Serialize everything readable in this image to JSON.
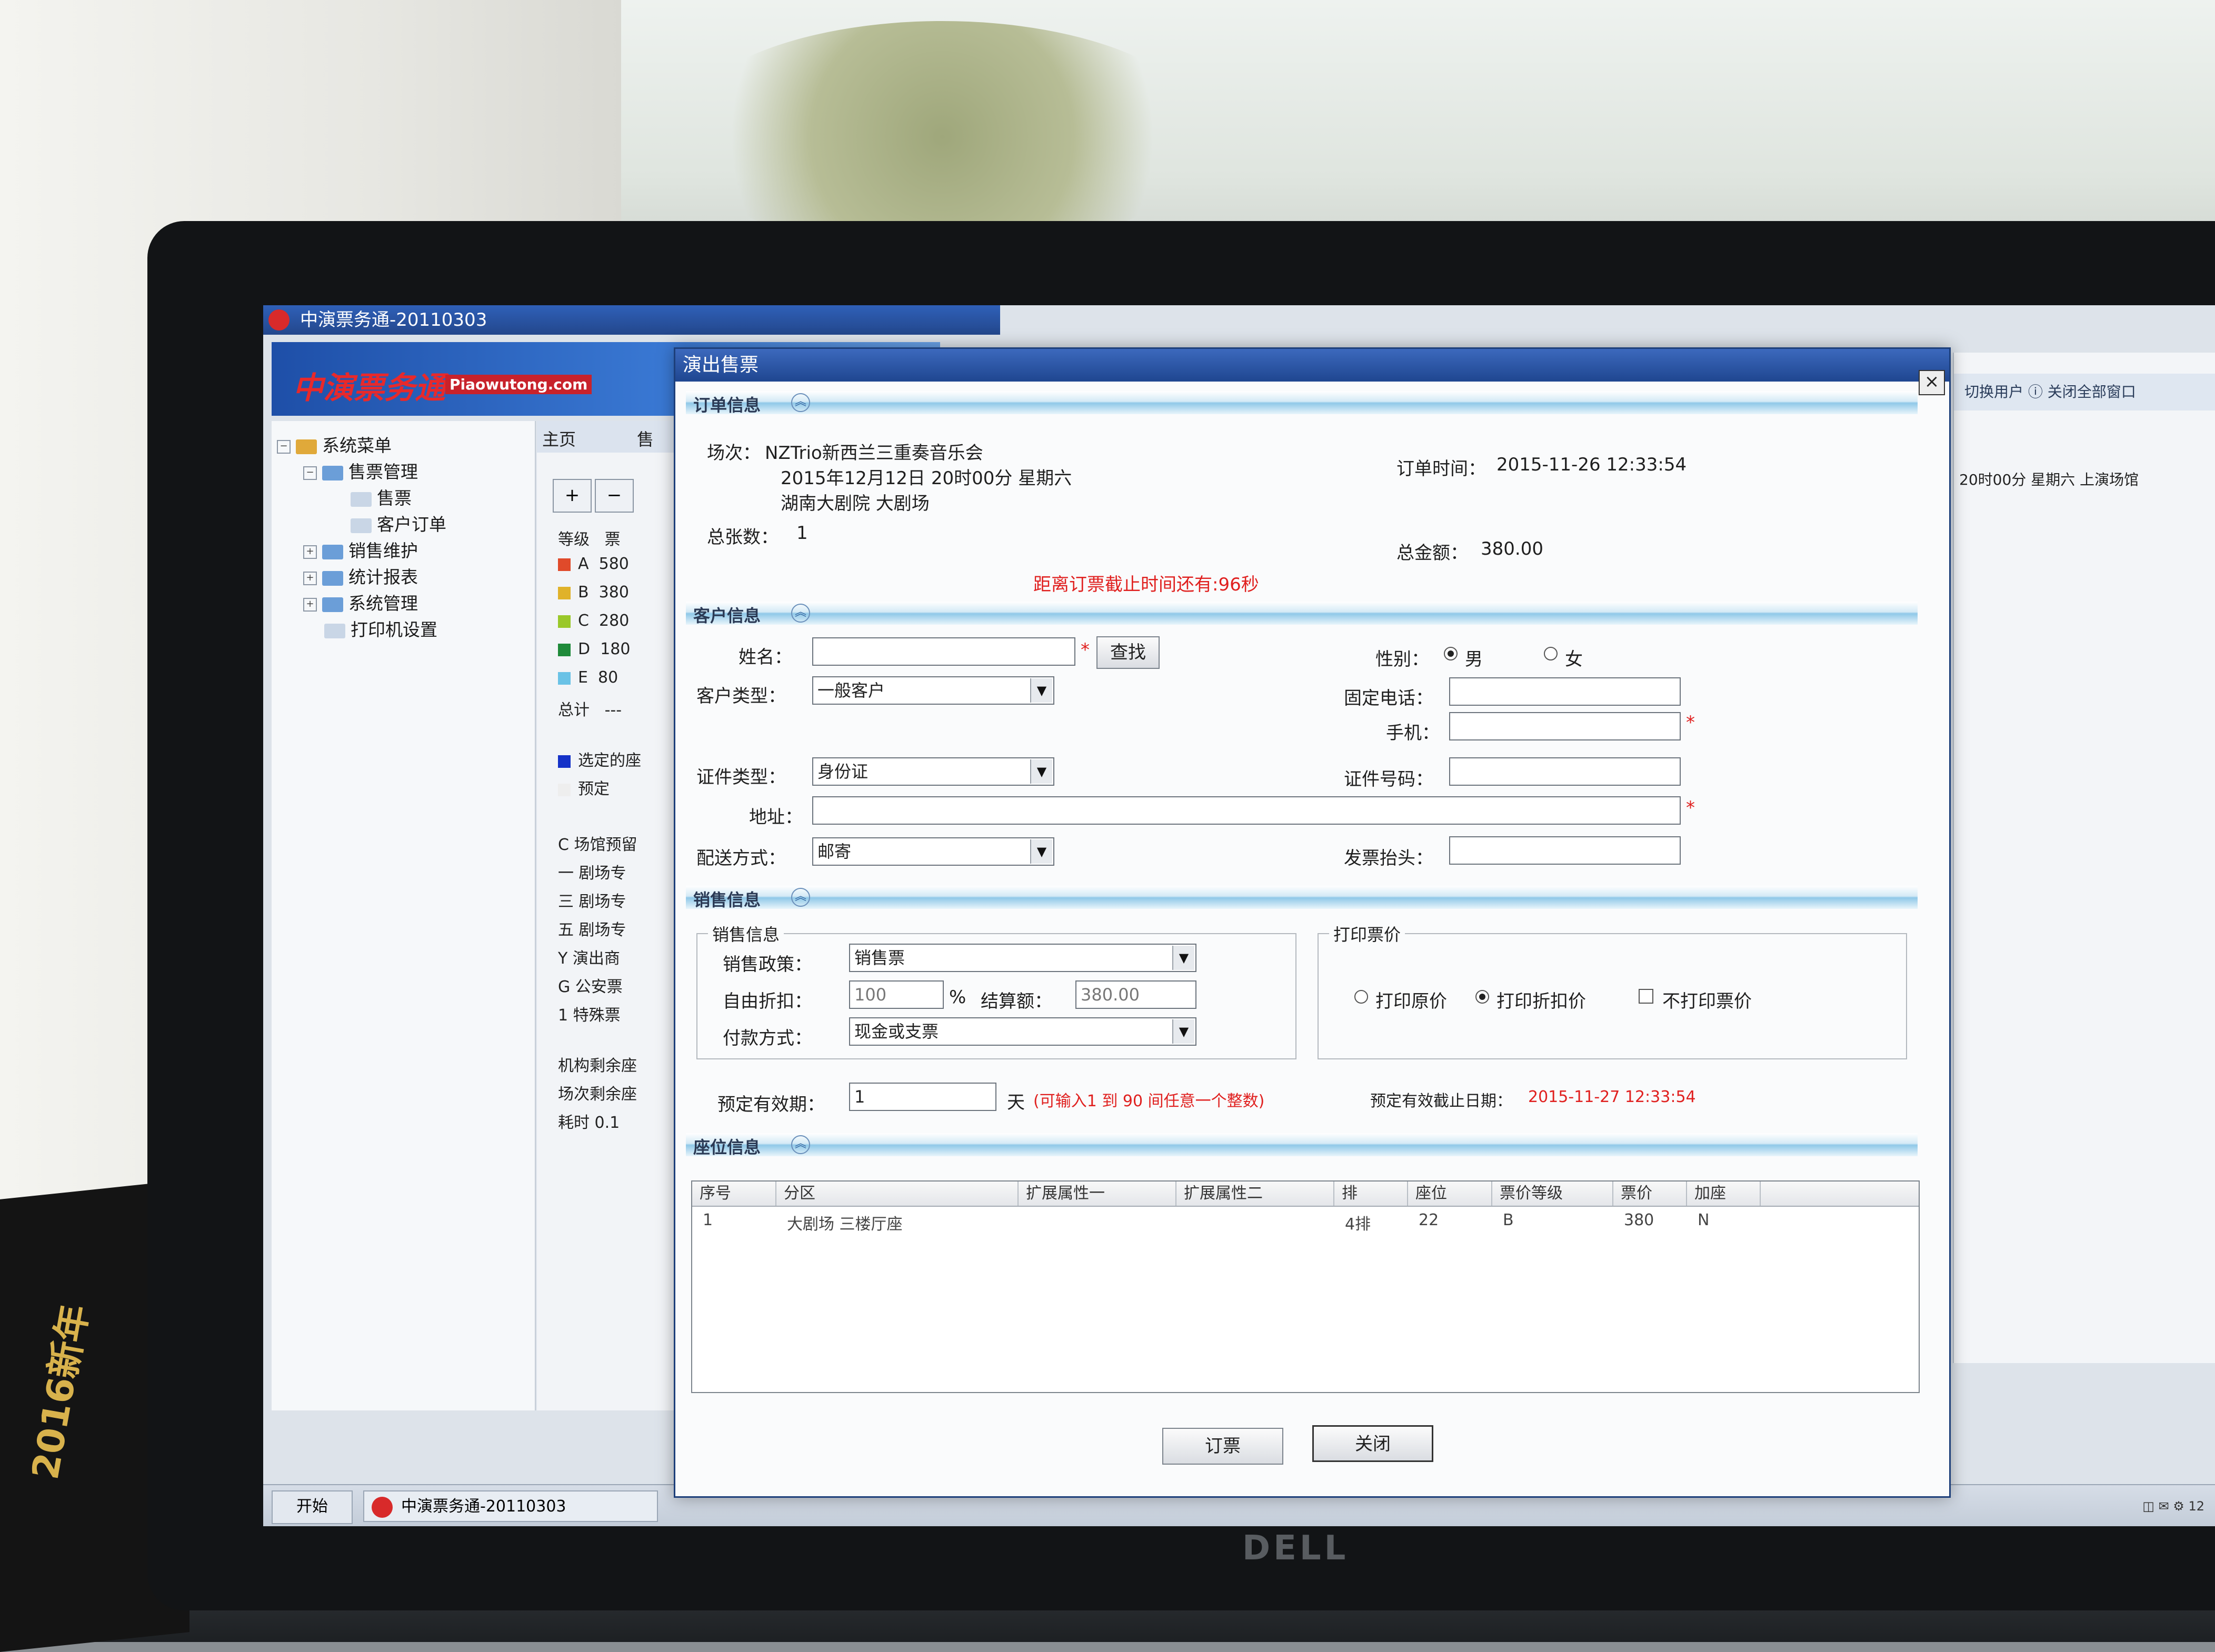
{
  "app": {
    "title": "中演票务通-20110303",
    "logo": "中演票务通",
    "logo_en": "Piaowutong.com",
    "tabs": [
      "主页",
      "售"
    ],
    "tool_buttons": [
      "+",
      "−"
    ],
    "grades_header": [
      "等级",
      "票"
    ],
    "grades": [
      {
        "grade": "A",
        "price": "580",
        "color": "#e04a2a"
      },
      {
        "grade": "B",
        "price": "380",
        "color": "#e0b22a"
      },
      {
        "grade": "C",
        "price": "280",
        "color": "#9ac82a"
      },
      {
        "grade": "D",
        "price": "180",
        "color": "#1f8a3a"
      },
      {
        "grade": "E",
        "price": "80",
        "color": "#6ac2e6"
      }
    ],
    "total_label": "总计",
    "total_value": "---",
    "legend": [
      "选定的座",
      "预定"
    ],
    "seat_types": [
      "C 场馆预留",
      "一 剧场专",
      "三 剧场专",
      "五 剧场专",
      "Y 演出商",
      "G 公安票",
      "1 特殊票"
    ],
    "footer_notes": [
      "机构剩余座",
      "场次剩余座",
      "耗时 0.1"
    ]
  },
  "sidebar": {
    "items": [
      {
        "label": "系统菜单",
        "level": 0,
        "expander": "−"
      },
      {
        "label": "售票管理",
        "level": 1,
        "expander": "−"
      },
      {
        "label": "售票",
        "level": 2,
        "expander": ""
      },
      {
        "label": "客户订单",
        "level": 2,
        "expander": ""
      },
      {
        "label": "销售维护",
        "level": 1,
        "expander": "+"
      },
      {
        "label": "统计报表",
        "level": 1,
        "expander": "+"
      },
      {
        "label": "系统管理",
        "level": 1,
        "expander": "+"
      },
      {
        "label": "打印机设置",
        "level": 1,
        "expander": ""
      }
    ]
  },
  "right_panel": {
    "toolbar": "切换用户  ⓘ 关闭全部窗口",
    "info": "20时00分   星期六   上演场馆"
  },
  "taskbar": {
    "start_label": "开始",
    "app_label": "中演票务通-20110303",
    "tray_text": "◫ ✉ ⚙ 12"
  },
  "dialog": {
    "title": "演出售票",
    "close_label": "×",
    "order": {
      "section_title": "订单信息",
      "show_label": "场次：",
      "show_name": "NZTrio新西兰三重奏音乐会",
      "show_time": "2015年12月12日 20时00分   星期六",
      "venue": "湖南大剧院 大剧场",
      "order_time_label": "订单时间：",
      "order_time": "2015-11-26 12:33:54",
      "count_label": "总张数：",
      "count": "1",
      "amount_label": "总金额：",
      "amount": "380.00",
      "deadline_notice": "距离订票截止时间还有:96秒"
    },
    "customer": {
      "section_title": "客户信息",
      "name_label": "姓名：",
      "name_value": "",
      "search_button": "查找",
      "gender_label": "性别：",
      "gender_male": "男",
      "gender_female": "女",
      "type_label": "客户类型：",
      "type_value": "一般客户",
      "phone_label": "固定电话：",
      "phone_value": "",
      "mobile_label": "手机：",
      "mobile_value": "",
      "id_type_label": "证件类型：",
      "id_type_value": "身份证",
      "id_no_label": "证件号码：",
      "id_no_value": "",
      "address_label": "地址：",
      "address_value": "",
      "delivery_label": "配送方式：",
      "delivery_value": "邮寄",
      "invoice_label": "发票抬头：",
      "invoice_value": ""
    },
    "sales": {
      "section_title": "销售信息",
      "group_title": "销售信息",
      "policy_label": "销售政策：",
      "policy_value": "销售票",
      "discount_label": "自由折扣：",
      "discount_value": "100",
      "percent": "%",
      "settle_label": "结算额：",
      "settle_value": "380.00",
      "payment_label": "付款方式：",
      "payment_value": "现金或支票",
      "print_group_title": "打印票价",
      "print_original": "打印原价",
      "print_discount": "打印折扣价",
      "no_print": "不打印票价",
      "valid_label": "预定有效期：",
      "valid_value": "1",
      "valid_unit": "天",
      "valid_hint": "(可输入1 到 90 间任意一个整数)",
      "valid_deadline_label": "预定有效截止日期：",
      "valid_deadline": "2015-11-27 12:33:54"
    },
    "seats": {
      "section_title": "座位信息",
      "columns": [
        "序号",
        "分区",
        "扩展属性一",
        "扩展属性二",
        "排",
        "座位",
        "票价等级",
        "票价",
        "加座"
      ],
      "rows": [
        {
          "no": "1",
          "zone": "大剧场 三楼厅座",
          "ext1": "",
          "ext2": "",
          "row": "4排",
          "seat": "22",
          "grade": "B",
          "price": "380",
          "extra": "N"
        }
      ]
    },
    "buttons": {
      "book": "订票",
      "close": "关闭"
    }
  },
  "monitor_brand": "DELL",
  "poster_text": "2016新年"
}
